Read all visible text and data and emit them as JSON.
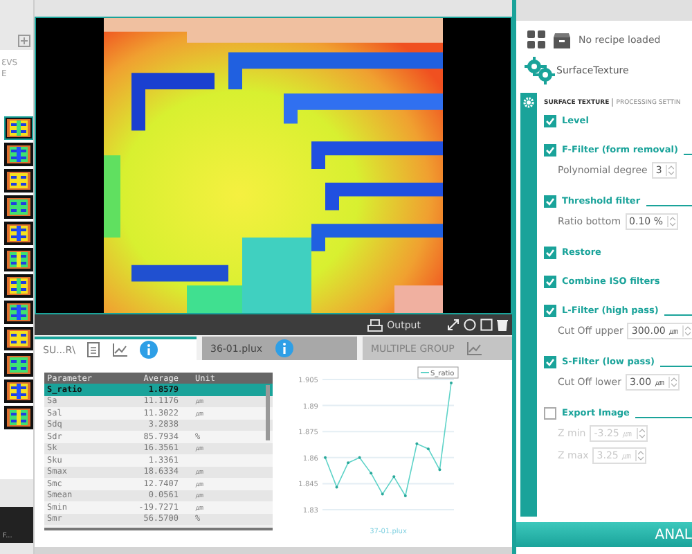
{
  "left_panel": {
    "text_fragments": [
      "ƐVS",
      "E"
    ],
    "thumbnails": [
      {
        "selected": true
      },
      {
        "selected": false
      },
      {
        "selected": false
      },
      {
        "selected": false
      },
      {
        "selected": false
      },
      {
        "selected": false
      },
      {
        "selected": false
      },
      {
        "selected": false
      },
      {
        "selected": false
      },
      {
        "selected": false
      },
      {
        "selected": false
      },
      {
        "selected": false
      }
    ],
    "footer": "F..."
  },
  "viewer": {
    "toolbar": {
      "output": "Output"
    }
  },
  "result_tabs": [
    {
      "label": "SU...R\\",
      "selected": true,
      "disabled": false,
      "kind": "summary"
    },
    {
      "label": "36-01.plux",
      "selected": false,
      "disabled": false,
      "kind": "file"
    },
    {
      "label": "MULTIPLE GROUP",
      "selected": false,
      "disabled": true,
      "kind": "group"
    }
  ],
  "table": {
    "columns": [
      "Parameter",
      "Average",
      "Unit"
    ],
    "rows": [
      {
        "cells": [
          "S_ratio",
          "1.8579",
          ""
        ],
        "selected": true
      },
      {
        "cells": [
          "Sa",
          "11.1176",
          "㎛"
        ],
        "selected": false
      },
      {
        "cells": [
          "Sal",
          "11.3022",
          "㎛"
        ],
        "selected": false
      },
      {
        "cells": [
          "Sdq",
          "3.2838",
          ""
        ],
        "selected": false
      },
      {
        "cells": [
          "Sdr",
          "85.7934",
          "%"
        ],
        "selected": false
      },
      {
        "cells": [
          "Sk",
          "16.3561",
          "㎛"
        ],
        "selected": false
      },
      {
        "cells": [
          "Sku",
          "1.3361",
          ""
        ],
        "selected": false
      },
      {
        "cells": [
          "Smax",
          "18.6334",
          "㎛"
        ],
        "selected": false
      },
      {
        "cells": [
          "Smc",
          "12.7407",
          "㎛"
        ],
        "selected": false
      },
      {
        "cells": [
          "Smean",
          "0.0561",
          "㎛"
        ],
        "selected": false
      },
      {
        "cells": [
          "Smin",
          "-19.7271",
          "㎛"
        ],
        "selected": false
      },
      {
        "cells": [
          "Smr",
          "56.5700",
          "%"
        ],
        "selected": false
      }
    ]
  },
  "chart_data": {
    "type": "line",
    "xlabel": "37-01.plux",
    "categories": [
      null,
      null,
      null,
      null,
      null,
      null,
      null,
      null,
      null,
      null,
      null,
      null
    ],
    "grid": true,
    "ylim": [
      1.83,
      1.905
    ],
    "yticks": [
      1.83,
      1.845,
      1.86,
      1.875,
      1.89,
      1.905
    ],
    "series": [
      {
        "name": "S_ratio",
        "color": "#5fd3c8",
        "values": [
          1.86,
          1.843,
          1.857,
          1.86,
          1.851,
          1.839,
          1.849,
          1.838,
          1.868,
          1.865,
          1.853,
          1.903
        ]
      }
    ]
  },
  "right_panel": {
    "recipe": "No recipe loaded",
    "app_name": "SurfaceTexture",
    "tabs": [
      {
        "label": "SURFACE TEXTURE",
        "selected": true
      },
      {
        "label": "PROCESSING SETTIN",
        "selected": false
      }
    ],
    "settings": [
      {
        "label": "Level",
        "checked": true
      },
      {
        "label": "F-Filter (form removal)",
        "checked": true,
        "params": [
          {
            "label": "Polynomial degree",
            "value": "3",
            "disabled": false
          }
        ]
      },
      {
        "label": "Threshold filter",
        "checked": true,
        "params": [
          {
            "label": "Ratio  bottom",
            "value": "0.10 %",
            "disabled": false
          }
        ]
      },
      {
        "label": "Restore",
        "checked": true
      },
      {
        "label": "Combine ISO filters",
        "checked": true
      },
      {
        "label": "L-Filter (high pass)",
        "checked": true,
        "params": [
          {
            "label": "Cut Off upper",
            "value": "300.00 ㎛",
            "disabled": false
          }
        ]
      },
      {
        "label": "S-Filter (low pass)",
        "checked": true,
        "params": [
          {
            "label": "Cut Off lower",
            "value": "3.00 ㎛",
            "disabled": false
          }
        ]
      },
      {
        "label": "Export Image",
        "checked": false,
        "params": [
          {
            "label": "Z min",
            "value": "-3.25 ㎛",
            "disabled": true
          },
          {
            "label": "Z max",
            "value": "3.25 ㎛",
            "disabled": true
          }
        ]
      }
    ],
    "analyze": "ANAL"
  }
}
